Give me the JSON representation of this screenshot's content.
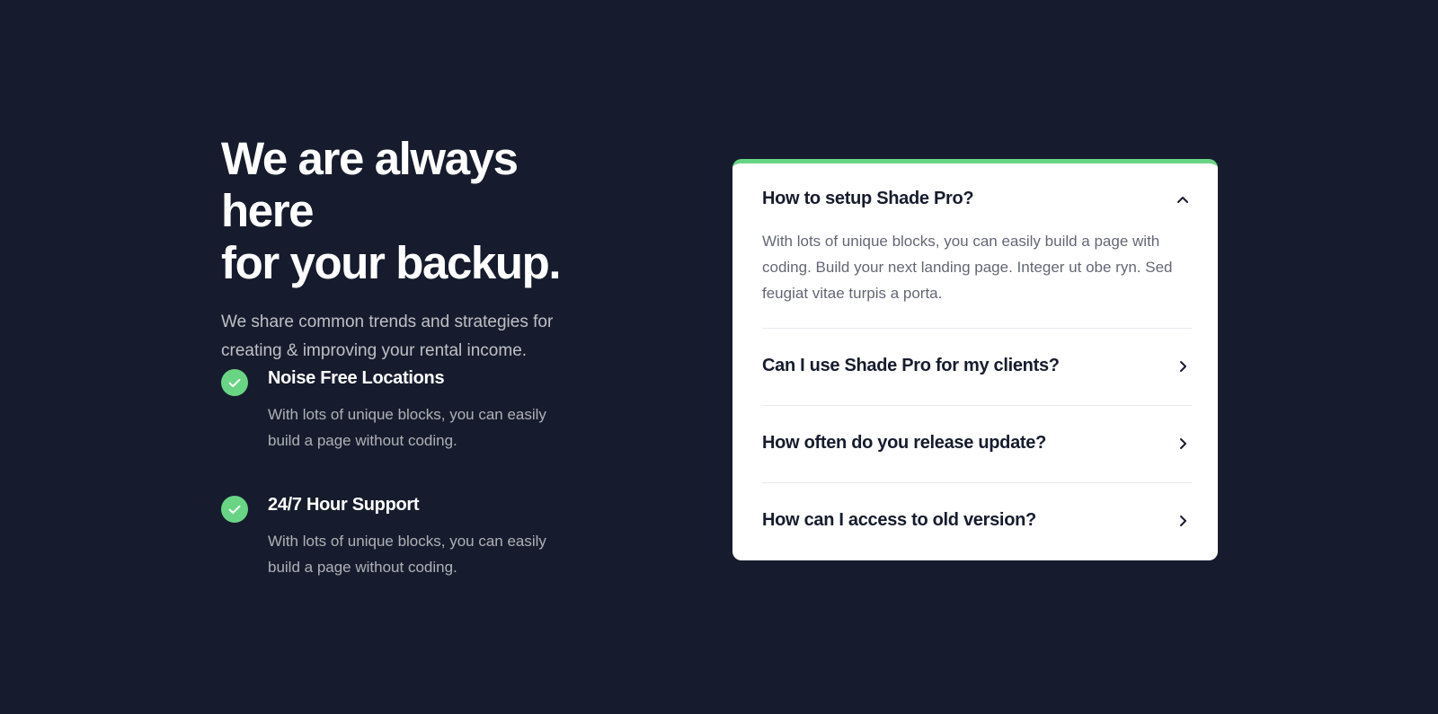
{
  "hero": {
    "headline_line1": "We are always here",
    "headline_line2": "for your backup.",
    "subtext": "We share common trends and strategies for creating & improving your rental income."
  },
  "features": [
    {
      "title": "Noise Free Locations",
      "description": "With lots of unique blocks, you can easily build a page without coding.",
      "icon": "check-circle-icon"
    },
    {
      "title": "24/7 Hour Support",
      "description": "With lots of unique blocks, you can easily build a page without coding.",
      "icon": "check-circle-icon"
    }
  ],
  "faq": {
    "items": [
      {
        "question": "How to setup Shade Pro?",
        "answer": "With lots of unique blocks, you can easily build a page with coding. Build your next landing page. Integer ut obe ryn. Sed feugiat vitae turpis a porta.",
        "expanded": true,
        "icon": "chevron-up-icon"
      },
      {
        "question": "Can I use Shade Pro for my clients?",
        "expanded": false,
        "icon": "chevron-right-icon"
      },
      {
        "question": "How often do you release update?",
        "expanded": false,
        "icon": "chevron-right-icon"
      },
      {
        "question": "How can I access to old version?",
        "expanded": false,
        "icon": "chevron-right-icon"
      }
    ]
  },
  "colors": {
    "background": "#161c2d",
    "accent": "#68d585",
    "card_background": "#ffffff",
    "text_dark": "#161c2d"
  }
}
